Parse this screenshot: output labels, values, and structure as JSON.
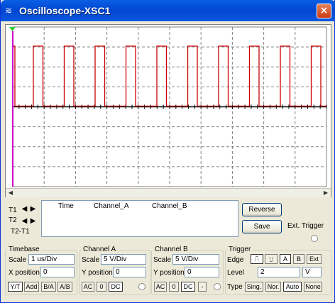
{
  "window": {
    "title": "Oscilloscope-XSC1",
    "close_glyph": "×"
  },
  "readout": {
    "col_time": "Time",
    "col_a": "Channel_A",
    "col_b": "Channel_B"
  },
  "cursors": {
    "t1": "T1",
    "t2": "T2",
    "t2t1": "T2-T1"
  },
  "actions": {
    "reverse": "Reverse",
    "save": "Save",
    "ext_trigger": "Ext. Trigger"
  },
  "timebase": {
    "title": "Timebase",
    "scale_label": "Scale",
    "scale": "1 us/Div",
    "xpos_label": "X position",
    "xpos": "0",
    "modes": [
      "Y/T",
      "Add",
      "B/A",
      "A/B"
    ],
    "active_mode": "Y/T"
  },
  "channel_a": {
    "title": "Channel A",
    "scale_label": "Scale",
    "scale": "5  V/Div",
    "ypos_label": "Y position",
    "ypos": "0",
    "coupling": [
      "AC",
      "0",
      "DC"
    ],
    "active": "DC"
  },
  "channel_b": {
    "title": "Channel B",
    "scale_label": "Scale",
    "scale": "5  V/Div",
    "ypos_label": "Y position",
    "ypos": "0",
    "coupling": [
      "AC",
      "0",
      "DC"
    ],
    "active": "DC",
    "minus": "-"
  },
  "trigger": {
    "title": "Trigger",
    "edge_label": "Edge",
    "edge_rise": "⎍",
    "edge_fall": "⎍",
    "src_a": "A",
    "src_b": "B",
    "src_ext": "Ext",
    "level_label": "Level",
    "level": "2",
    "level_unit": "V",
    "type_label": "Type",
    "types": [
      "Sing.",
      "Nor.",
      "Auto",
      "None"
    ],
    "active_type": "Auto"
  },
  "colors": {
    "grid": "#808080",
    "trace_a": "#cc0000",
    "trace_b": "#000000",
    "marker": "#cc00cc",
    "screen_bg": "#ffffff"
  },
  "icons": {
    "title": "oscilloscope-icon",
    "close": "close-icon",
    "left": "arrow-left-icon",
    "right": "arrow-right-icon"
  }
}
